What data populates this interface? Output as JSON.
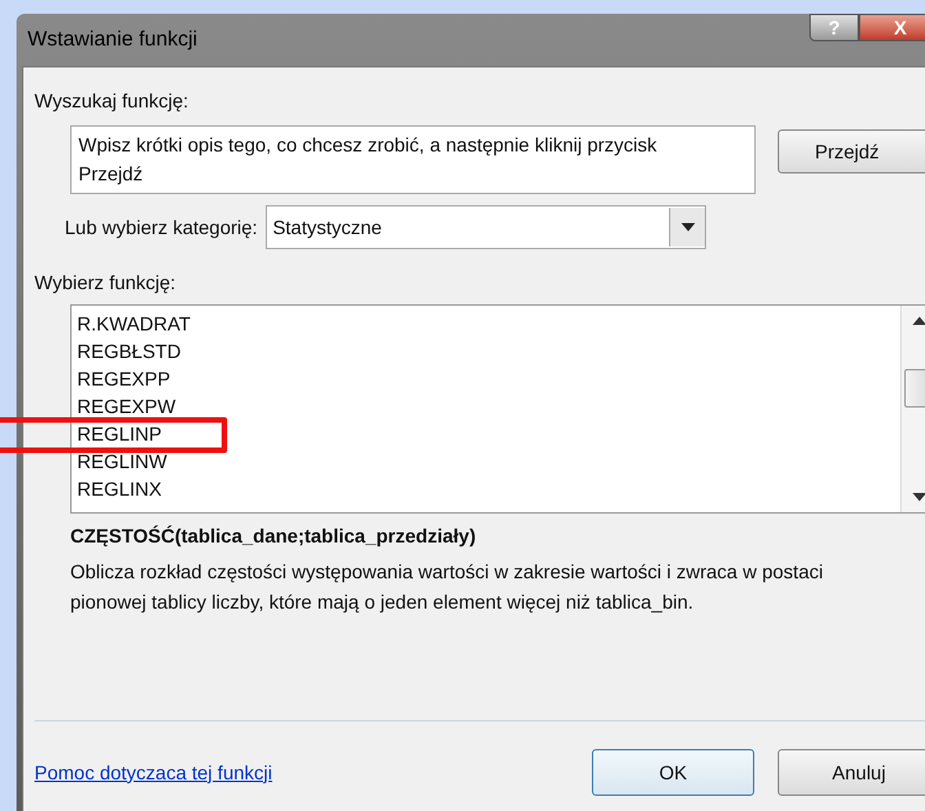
{
  "window": {
    "title": "Wstawianie funkcji",
    "buttons": [
      "?",
      "X"
    ]
  },
  "search": {
    "label": "Wyszukaj funkcję:",
    "value": "Wpisz krótki opis tego, co chcesz zrobić, a następnie kliknij przycisk Przejdź",
    "button": "Przejdź"
  },
  "category": {
    "label": "Lub wybierz kategorię:",
    "value": "Statystyczne"
  },
  "functions": {
    "label": "Wybierz funkcję:",
    "items": [
      {
        "name": "R.KWADRAT",
        "highlighted": false
      },
      {
        "name": "REGBŁSTD",
        "highlighted": false
      },
      {
        "name": "REGEXPP",
        "highlighted": false
      },
      {
        "name": "REGEXPW",
        "highlighted": false
      },
      {
        "name": "REGLINP",
        "highlighted": true
      },
      {
        "name": "REGLINW",
        "highlighted": false
      },
      {
        "name": "REGLINX",
        "highlighted": false
      }
    ]
  },
  "signature": "CZĘSTOŚĆ(tablica_dane;tablica_przedziały)",
  "description": "Oblicza rozkład częstości występowania wartości w zakresie wartości i zwraca w postaci pionowej tablicy liczby, które mają o jeden element więcej niż tablica_bin.",
  "help_link": "Pomoc dotyczaca tej funkcji",
  "buttons": [
    "OK",
    "Anuluj"
  ]
}
